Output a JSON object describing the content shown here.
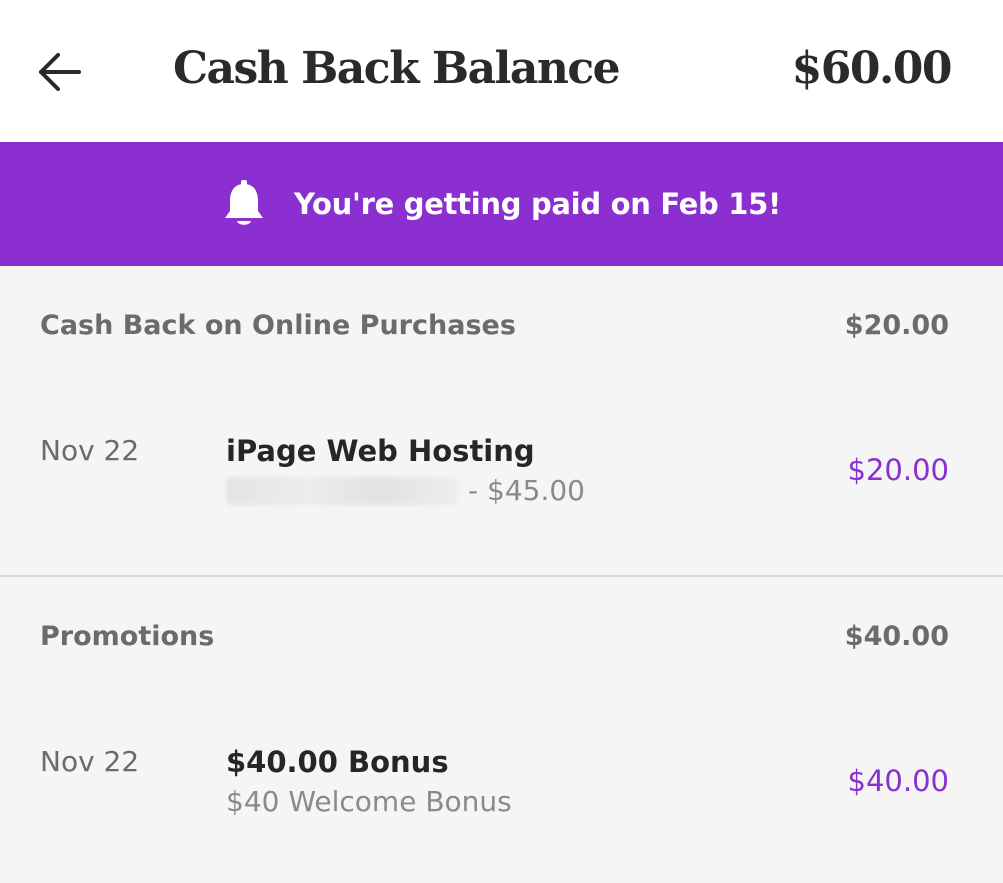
{
  "header": {
    "title": "Cash Back Balance",
    "total_balance": "$60.00",
    "back_icon": "arrow-left-icon"
  },
  "banner": {
    "icon": "bell-icon",
    "message": "You're getting paid on Feb 15!",
    "background_color": "#8b2fd0"
  },
  "sections": [
    {
      "label": "Cash Back on Online Purchases",
      "amount": "$20.00",
      "transactions": [
        {
          "date": "Nov 22",
          "title": "iPage Web Hosting",
          "detail": "- $45.00",
          "cashback": "$20.00"
        }
      ]
    },
    {
      "label": "Promotions",
      "amount": "$40.00",
      "transactions": [
        {
          "date": "Nov 22",
          "title": "$40.00 Bonus",
          "detail": "$40 Welcome Bonus",
          "cashback": "$40.00"
        }
      ]
    }
  ],
  "colors": {
    "accent": "#8b2fd0",
    "muted_text": "#6b6b6b"
  }
}
